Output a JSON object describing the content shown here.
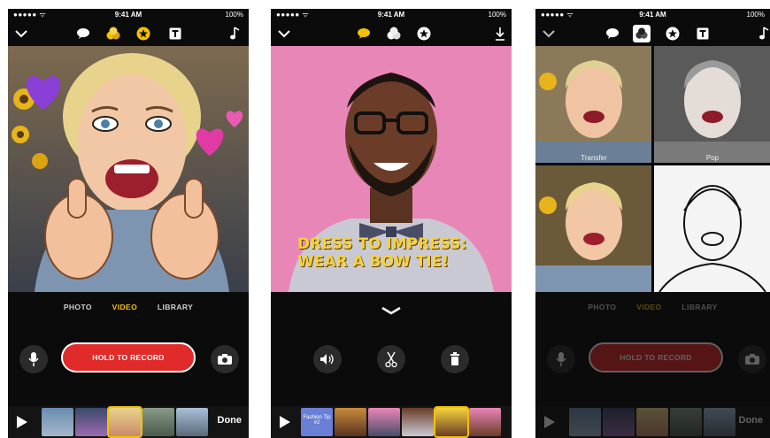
{
  "status_bar": {
    "signal": "●●●●● ᯤ",
    "time": "9:41 AM",
    "battery": "100%"
  },
  "screen1": {
    "modes": [
      "PHOTO",
      "VIDEO",
      "LIBRARY"
    ],
    "active_mode": "VIDEO",
    "record_label": "HOLD TO RECORD",
    "done_label": "Done"
  },
  "screen2": {
    "caption_line1": "DRESS TO IMPRESS:",
    "caption_line2": "WEAR A BOW TIE!",
    "thumb_label": "Fashion Tip #2"
  },
  "screen3": {
    "filter_labels": [
      "Transfer",
      "Pop"
    ],
    "modes": [
      "PHOTO",
      "VIDEO",
      "LIBRARY"
    ],
    "record_label": "HOLD TO RECORD",
    "done_label": "Done"
  },
  "colors": {
    "accent_yellow": "#f2c200",
    "record_red": "#e12a2a",
    "caption_yellow": "#f5d33a"
  }
}
